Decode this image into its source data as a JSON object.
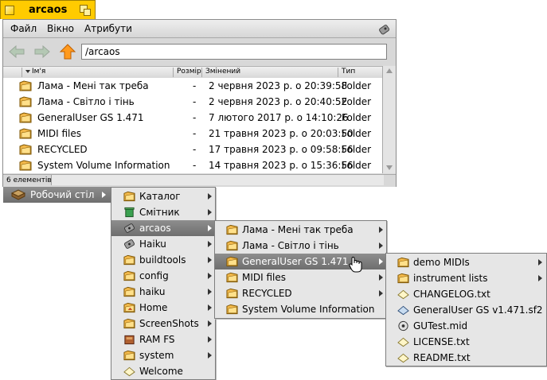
{
  "window": {
    "title": "arcaos",
    "menu": [
      "Файл",
      "Вікно",
      "Атрибути"
    ],
    "path": "/arcaos",
    "columns": {
      "name": "Ім'я",
      "size": "Розмір",
      "modified": "Змінений",
      "type": "Тип"
    },
    "rows": [
      {
        "name": "Лама - Мені так треба",
        "size": "-",
        "modified": "2 червня 2023 р. о 20:39:58",
        "type": "Folder"
      },
      {
        "name": "Лама - Світло і тінь",
        "size": "-",
        "modified": "2 червня 2023 р. о 20:40:52",
        "type": "Folder"
      },
      {
        "name": "GeneralUser GS 1.471",
        "size": "-",
        "modified": "7 лютого 2017 р. о 14:10:26",
        "type": "Folder"
      },
      {
        "name": "MIDI files",
        "size": "-",
        "modified": "21 травня 2023 р. о 20:03:50",
        "type": "Folder"
      },
      {
        "name": "RECYCLED",
        "size": "-",
        "modified": "17 травня 2023 р. о 09:58:56",
        "type": "Folder"
      },
      {
        "name": "System Volume Information",
        "size": "-",
        "modified": "14 травня 2023 р. о 15:36:56",
        "type": "Folder"
      }
    ],
    "status": "6 елементів"
  },
  "root_menu": {
    "label": "Робочий стіл"
  },
  "menu1": {
    "items": [
      {
        "label": "Каталог",
        "icon": "folder-icon"
      },
      {
        "label": "Смітник",
        "icon": "trash-icon"
      },
      {
        "label": "arcaos",
        "icon": "disk-icon"
      },
      {
        "label": "Haiku",
        "icon": "disk-icon"
      },
      {
        "label": "buildtools",
        "icon": "folder-icon"
      },
      {
        "label": "config",
        "icon": "folder-icon"
      },
      {
        "label": "haiku",
        "icon": "folder-icon"
      },
      {
        "label": "Home",
        "icon": "home-folder-icon"
      },
      {
        "label": "ScreenShots",
        "icon": "folder-icon"
      },
      {
        "label": "RAM FS",
        "icon": "ramfs-icon"
      },
      {
        "label": "system",
        "icon": "folder-icon"
      },
      {
        "label": "Welcome",
        "icon": "document-icon"
      }
    ]
  },
  "menu2": {
    "items": [
      {
        "label": "Лама - Мені так треба"
      },
      {
        "label": "Лама - Світло і тінь"
      },
      {
        "label": "GeneralUser GS 1.471"
      },
      {
        "label": "MIDI files"
      },
      {
        "label": "RECYCLED"
      },
      {
        "label": "System Volume Information"
      }
    ]
  },
  "menu3": {
    "items": [
      {
        "label": "demo MIDIs",
        "icon": "folder-icon"
      },
      {
        "label": "instrument lists",
        "icon": "folder-icon"
      },
      {
        "label": "CHANGELOG.txt",
        "icon": "document-icon"
      },
      {
        "label": "GeneralUser GS v1.471.sf2",
        "icon": "soundfont-icon"
      },
      {
        "label": "GUTest.mid",
        "icon": "midi-icon"
      },
      {
        "label": "LICENSE.txt",
        "icon": "document-icon"
      },
      {
        "label": "README.txt",
        "icon": "document-icon"
      }
    ]
  },
  "colors": {
    "tab": "#ffcb00",
    "folder": "#f2b84a",
    "selection": "#7c7c7c"
  }
}
